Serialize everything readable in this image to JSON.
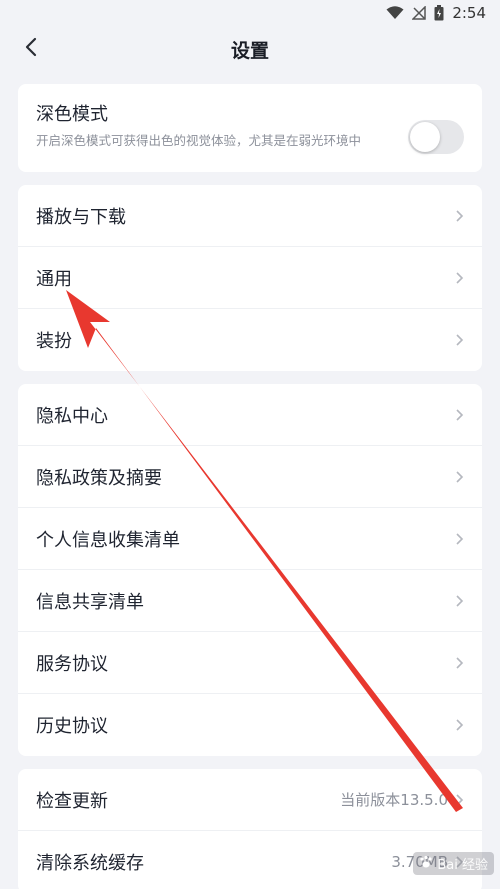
{
  "status_bar": {
    "time": "2:54",
    "icons": [
      "wifi-icon",
      "no-signal-icon",
      "battery-charging-icon"
    ]
  },
  "header": {
    "title": "设置",
    "back_icon": "chevron-left-icon"
  },
  "dark_mode": {
    "title": "深色模式",
    "description": "开启深色模式可获得出色的视觉体验，尤其是在弱光环境中",
    "enabled": false
  },
  "group1": [
    {
      "label": "播放与下载"
    },
    {
      "label": "通用"
    },
    {
      "label": "装扮"
    }
  ],
  "group2": [
    {
      "label": "隐私中心"
    },
    {
      "label": "隐私政策及摘要"
    },
    {
      "label": "个人信息收集清单"
    },
    {
      "label": "信息共享清单"
    },
    {
      "label": "服务协议"
    },
    {
      "label": "历史协议"
    }
  ],
  "group3": [
    {
      "label": "检查更新",
      "value": "当前版本13.5.0"
    },
    {
      "label": "清除系统缓存",
      "value": "3.70MB"
    }
  ],
  "annotation": {
    "color": "#e8382f",
    "points_to": "通用"
  },
  "watermark": {
    "text": "Bai 经验"
  }
}
